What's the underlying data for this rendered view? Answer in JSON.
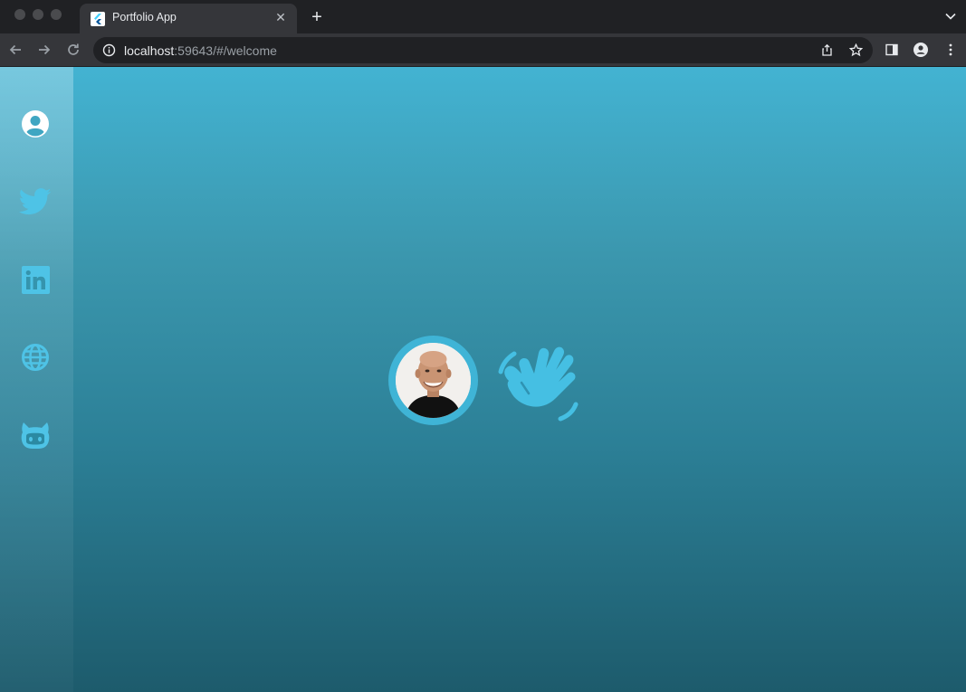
{
  "browser": {
    "tab_title": "Portfolio App",
    "tab_close_glyph": "✕",
    "new_tab_glyph": "+",
    "url_host": "localhost",
    "url_rest": ":59643/#/welcome"
  },
  "colors": {
    "accent": "#3fb4d6",
    "gradient_top": "#43b3d2",
    "gradient_bottom": "#1d5b6c"
  },
  "sidebar": {
    "items": [
      {
        "icon": "profile-icon"
      },
      {
        "icon": "twitter-icon"
      },
      {
        "icon": "linkedin-icon"
      },
      {
        "icon": "globe-icon"
      },
      {
        "icon": "github-icon"
      }
    ]
  },
  "hero": {
    "avatar": "avatar",
    "wave_icon": "waving-hand-icon"
  }
}
